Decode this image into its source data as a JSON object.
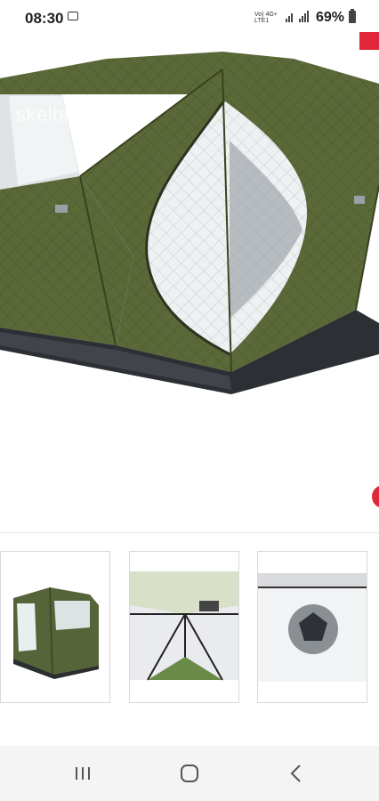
{
  "status_bar": {
    "time": "08:30",
    "network_line1": "Vo) 4G+",
    "network_line2": "LTE1",
    "battery_percent": "69%"
  },
  "watermark": "skelbiu.lt",
  "colors": {
    "accent_red": "#e0283a",
    "tent_green": "#5a6738",
    "quilt_white": "#eef0f2"
  },
  "thumbnails": [
    {
      "name": "tent-exterior-thumbnail"
    },
    {
      "name": "tent-interior-ceiling-thumbnail"
    },
    {
      "name": "tent-floor-hole-thumbnail"
    }
  ],
  "nav": {
    "recents_icon": "recents-icon",
    "home_icon": "home-icon",
    "back_icon": "back-icon"
  }
}
